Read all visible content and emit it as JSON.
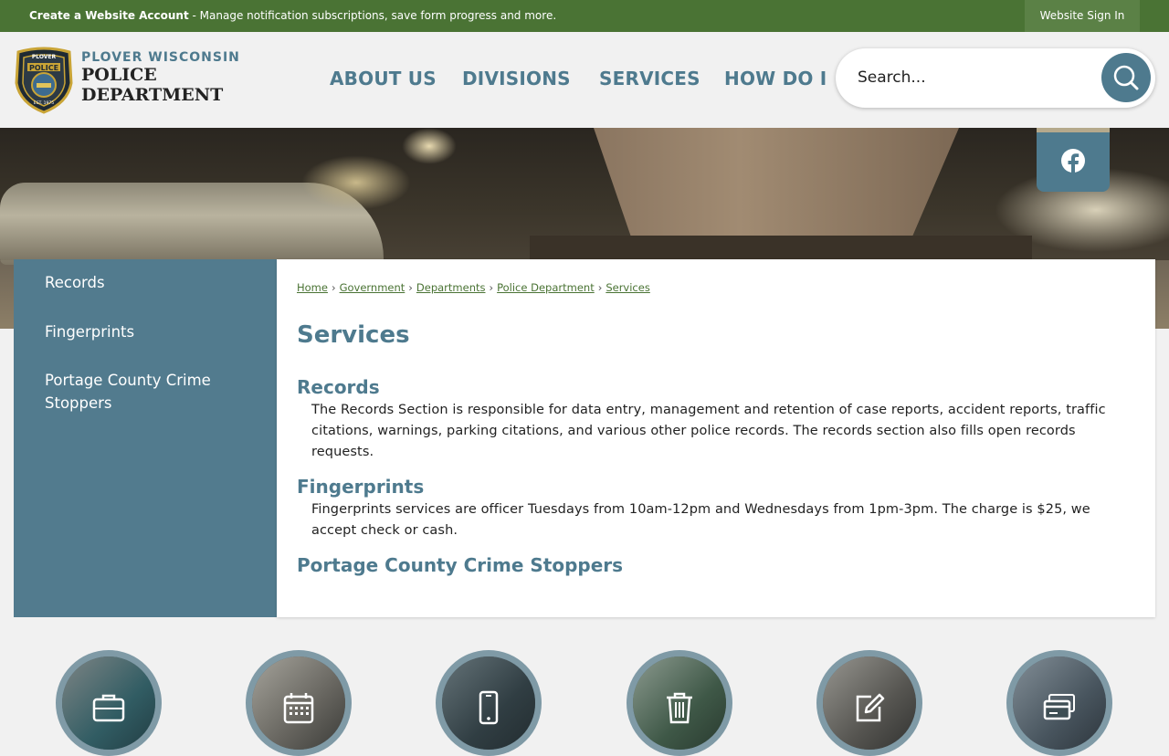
{
  "topbar": {
    "promo_bold": "Create a Website Account",
    "promo_rest": " - Manage notification subscriptions, save form progress and more.",
    "signin": "Website Sign In"
  },
  "logo": {
    "line1": "PLOVER WISCONSIN",
    "line2": "POLICE",
    "line3": "DEPARTMENT",
    "badge_top": "PLOVER",
    "badge_mid": "POLICE",
    "badge_est": "EST. 1975"
  },
  "nav": {
    "items": [
      {
        "label": "ABOUT US"
      },
      {
        "label": "DIVISIONS"
      },
      {
        "label": "SERVICES"
      },
      {
        "label": "HOW DO I"
      }
    ]
  },
  "search": {
    "placeholder": "Search..."
  },
  "social": {
    "facebook_icon": "facebook-icon"
  },
  "sidebar": {
    "items": [
      {
        "label": "Records"
      },
      {
        "label": "Fingerprints"
      },
      {
        "label": "Portage County Crime Stoppers"
      }
    ]
  },
  "breadcrumb": {
    "items": [
      "Home",
      "Government",
      "Departments",
      "Police Department",
      "Services"
    ],
    "separator": "›"
  },
  "page": {
    "title": "Services",
    "sections": [
      {
        "heading": "Records",
        "body": "The Records Section is responsible for data entry, management and retention of case reports, accident reports, traffic citations, warnings, parking citations, and various other police records. The records section also fills open records requests."
      },
      {
        "heading": "Fingerprints",
        "body": "Fingerprints services are officer Tuesdays from 10am-12pm and Wednesdays from 1pm-3pm. The charge is $25, we accept check or cash."
      },
      {
        "heading": "Portage County Crime Stoppers",
        "body": ""
      }
    ]
  },
  "quick_links": {
    "icons": [
      "briefcase-icon",
      "calendar-icon",
      "smartphone-icon",
      "trash-can-icon",
      "edit-form-icon",
      "payment-card-icon"
    ]
  },
  "colors": {
    "topbar_green": "#4a7334",
    "brand_blue": "#4e7a8e",
    "sidebar_blue": "#527b8e",
    "link_green": "#4a7334"
  }
}
